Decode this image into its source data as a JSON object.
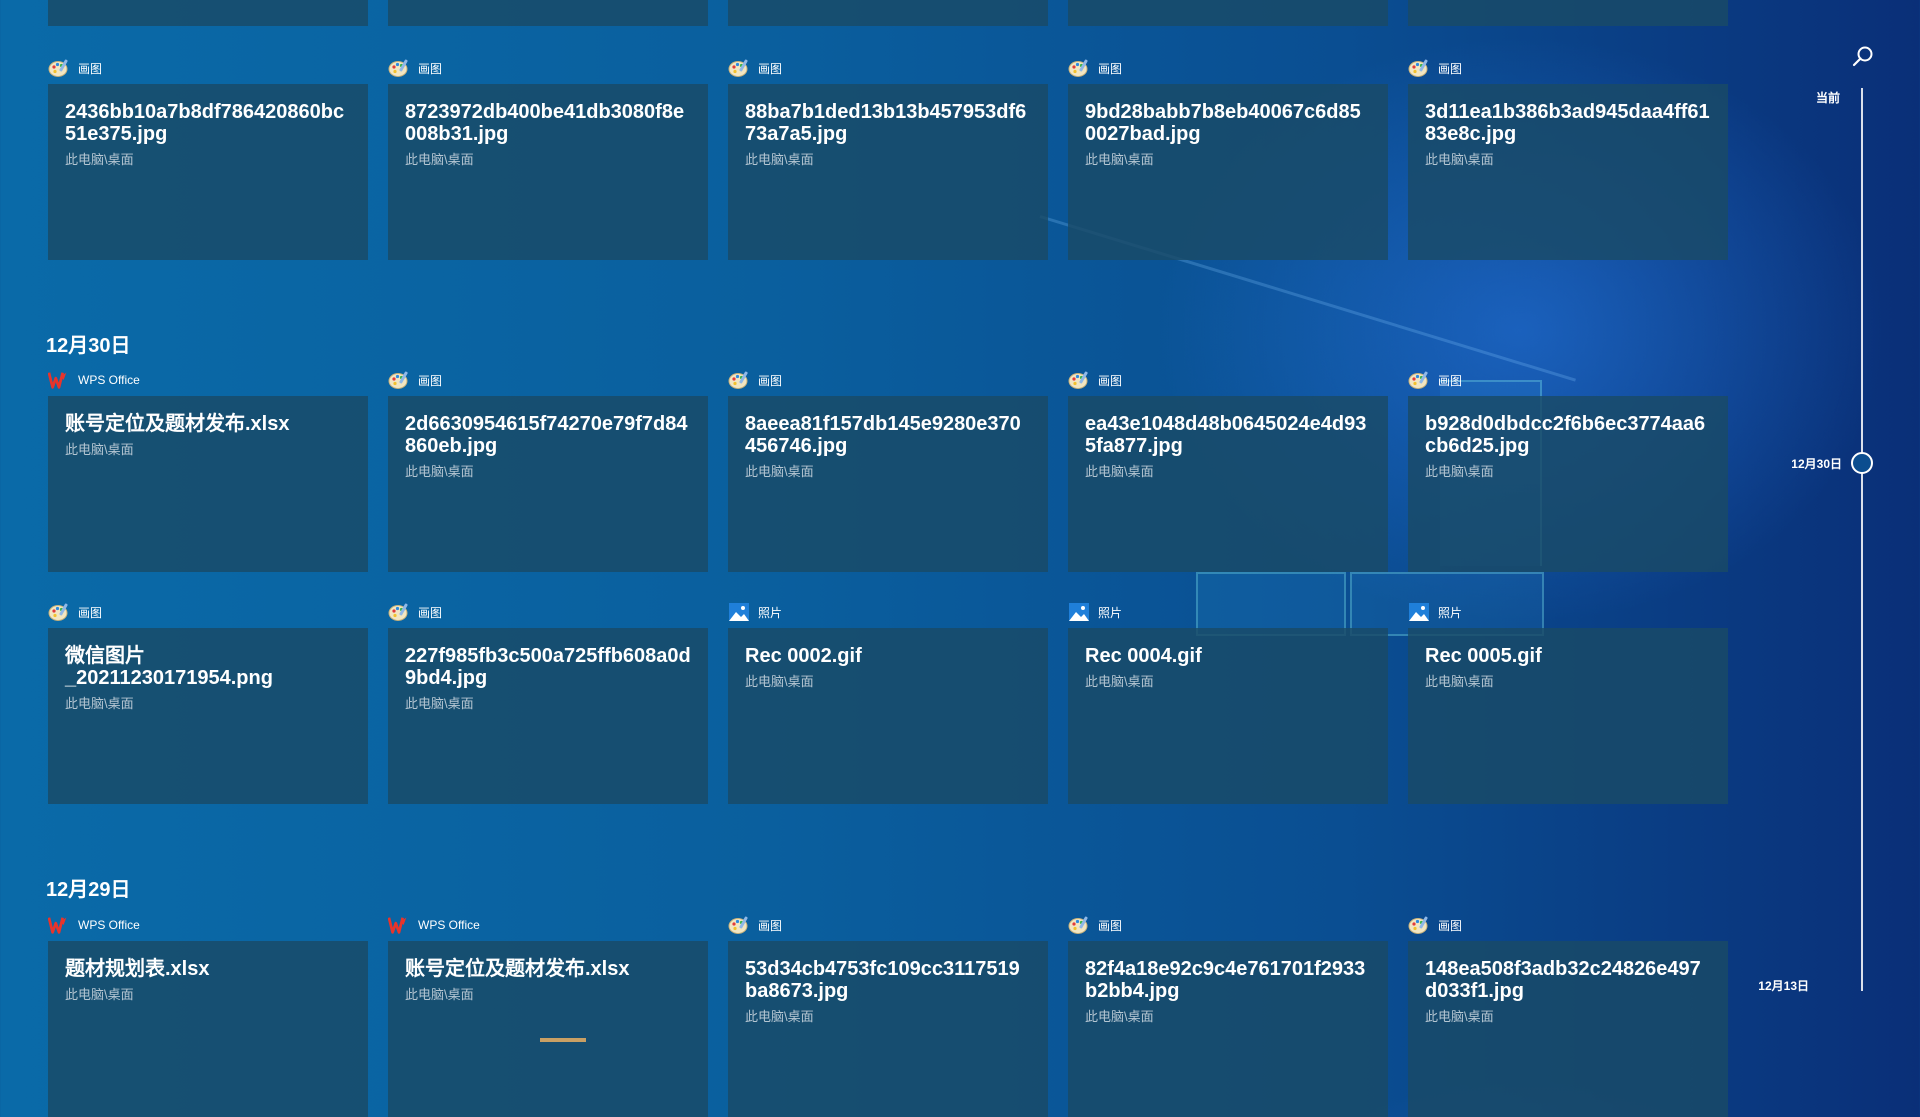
{
  "timeline": {
    "now_label": "当前",
    "mid_label": "12月30日",
    "bottom_label": "12月13日"
  },
  "sections": [
    {
      "date": "",
      "rows": [
        [
          {
            "app": "画图",
            "app_icon": "paint-icon",
            "title": "2436bb10a7b8df786420860bc51e375.jpg",
            "location": "此电脑\\桌面"
          },
          {
            "app": "画图",
            "app_icon": "paint-icon",
            "title": "8723972db400be41db3080f8e008b31.jpg",
            "location": "此电脑\\桌面"
          },
          {
            "app": "画图",
            "app_icon": "paint-icon",
            "title": "88ba7b1ded13b13b457953df673a7a5.jpg",
            "location": "此电脑\\桌面"
          },
          {
            "app": "画图",
            "app_icon": "paint-icon",
            "title": "9bd28babb7b8eb40067c6d850027bad.jpg",
            "location": "此电脑\\桌面"
          },
          {
            "app": "画图",
            "app_icon": "paint-icon",
            "title": "3d11ea1b386b3ad945daa4ff6183e8c.jpg",
            "location": "此电脑\\桌面"
          }
        ]
      ]
    },
    {
      "date": "12月30日",
      "rows": [
        [
          {
            "app": "WPS Office",
            "app_icon": "wps-icon",
            "title": "账号定位及题材发布.xlsx",
            "location": "此电脑\\桌面"
          },
          {
            "app": "画图",
            "app_icon": "paint-icon",
            "title": "2d6630954615f74270e79f7d84860eb.jpg",
            "location": "此电脑\\桌面"
          },
          {
            "app": "画图",
            "app_icon": "paint-icon",
            "title": "8aeea81f157db145e9280e370456746.jpg",
            "location": "此电脑\\桌面"
          },
          {
            "app": "画图",
            "app_icon": "paint-icon",
            "title": "ea43e1048d48b0645024e4d935fa877.jpg",
            "location": "此电脑\\桌面"
          },
          {
            "app": "画图",
            "app_icon": "paint-icon",
            "title": "b928d0dbdcc2f6b6ec3774aa6cb6d25.jpg",
            "location": "此电脑\\桌面"
          }
        ],
        [
          {
            "app": "画图",
            "app_icon": "paint-icon",
            "title": "微信图片\n_20211230171954.png",
            "location": "此电脑\\桌面"
          },
          {
            "app": "画图",
            "app_icon": "paint-icon",
            "title": "227f985fb3c500a725ffb608a0d9bd4.jpg",
            "location": "此电脑\\桌面"
          },
          {
            "app": "照片",
            "app_icon": "photos-icon",
            "title": "Rec 0002.gif",
            "location": "此电脑\\桌面"
          },
          {
            "app": "照片",
            "app_icon": "photos-icon",
            "title": "Rec 0004.gif",
            "location": "此电脑\\桌面"
          },
          {
            "app": "照片",
            "app_icon": "photos-icon",
            "title": "Rec 0005.gif",
            "location": "此电脑\\桌面"
          }
        ]
      ]
    },
    {
      "date": "12月29日",
      "rows": [
        [
          {
            "app": "WPS Office",
            "app_icon": "wps-icon",
            "title": "题材规划表.xlsx",
            "location": "此电脑\\桌面"
          },
          {
            "app": "WPS Office",
            "app_icon": "wps-icon",
            "title": "账号定位及题材发布.xlsx",
            "location": "此电脑\\桌面"
          },
          {
            "app": "画图",
            "app_icon": "paint-icon",
            "title": "53d34cb4753fc109cc3117519ba8673.jpg",
            "location": "此电脑\\桌面"
          },
          {
            "app": "画图",
            "app_icon": "paint-icon",
            "title": "82f4a18e92c9c4e761701f2933b2bb4.jpg",
            "location": "此电脑\\桌面"
          },
          {
            "app": "画图",
            "app_icon": "paint-icon",
            "title": "148ea508f3adb32c24826e497d033f1.jpg",
            "location": "此电脑\\桌面"
          }
        ]
      ]
    }
  ]
}
